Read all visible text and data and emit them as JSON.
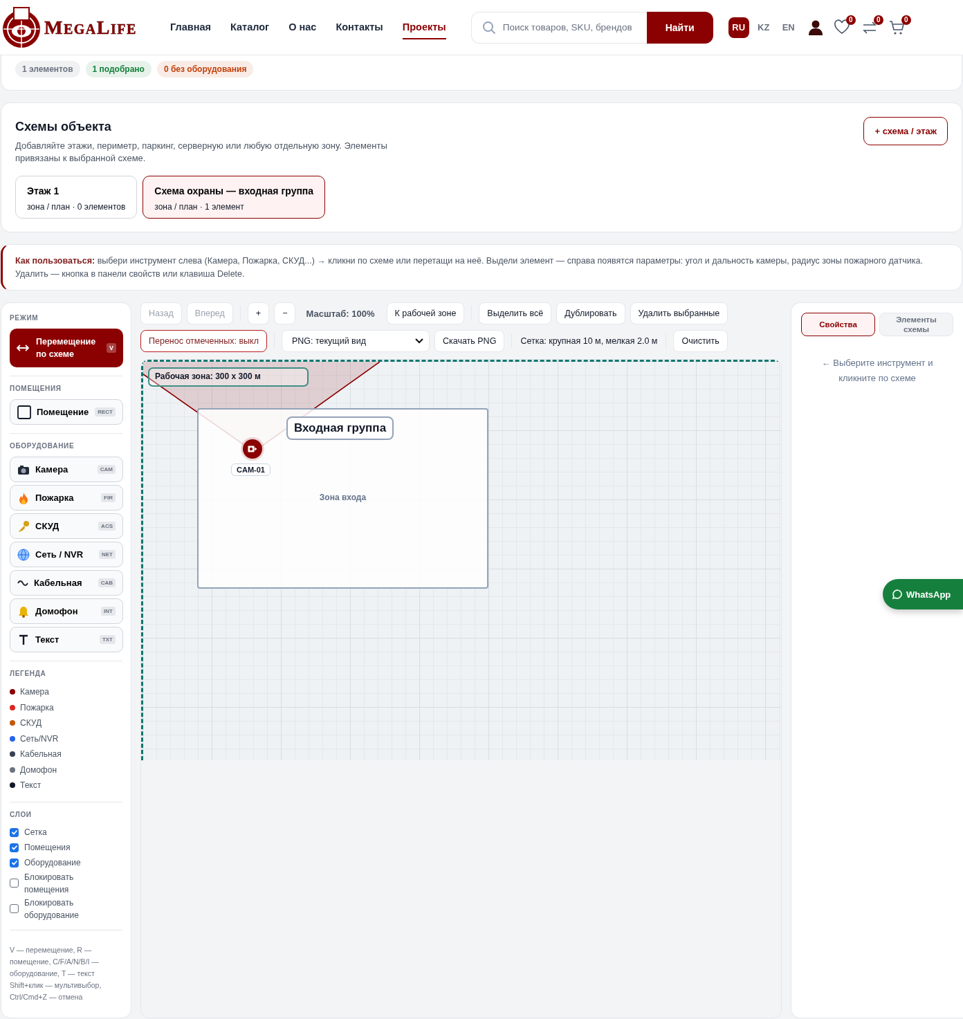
{
  "header": {
    "brand": "MegaLife",
    "nav": [
      {
        "label": "Главная",
        "selected": false
      },
      {
        "label": "Каталог",
        "selected": false
      },
      {
        "label": "О нас",
        "selected": false
      },
      {
        "label": "Контакты",
        "selected": false
      },
      {
        "label": "Проекты",
        "selected": true
      }
    ],
    "search": {
      "placeholder": "Поиск товаров, SKU, брендов",
      "button": "Найти"
    },
    "languages": [
      {
        "label": "RU",
        "selected": true
      },
      {
        "label": "KZ",
        "selected": false
      },
      {
        "label": "EN",
        "selected": false
      }
    ],
    "counters": [
      "0",
      "0",
      "0"
    ]
  },
  "stats": [
    {
      "text": "1 элементов",
      "color": "#6b7280"
    },
    {
      "text": "1 подобрано",
      "color": "#15803d"
    },
    {
      "text": "0 без оборудования",
      "color": "#c2410c"
    }
  ],
  "schemes": {
    "title": "Схемы объекта",
    "description": "Добавляйте этажи, периметр, паркинг, серверную или любую отдельную зону. Элементы привязаны к выбранной схеме.",
    "add_button": "+ схема / этаж",
    "items": [
      {
        "name": "Этаж 1",
        "meta": "зона / план · 0 элементов",
        "selected": false
      },
      {
        "name": "Схема охраны — входная группа",
        "meta": "зона / план · 1 элемент",
        "selected": true
      }
    ]
  },
  "help": "**Как пользоваться:** выбери инструмент слева (Камера, Пожарка, СКУД...) → кликни по схеме или перетащи на неё. Выдели элемент — справа появятся параметры: угол и дальность камеры, радиус зоны пожарного датчика. Удалить — кнопка в панели свойств или клавиша Delete.",
  "sidebar": {
    "mode_title": "РЕЖИМ",
    "mode": {
      "label": "Перемещение по схеме",
      "key": "V"
    },
    "rooms_title": "ПОМЕЩЕНИЯ",
    "rooms": [
      {
        "label": "Помещение",
        "code": "RECT"
      }
    ],
    "equipment_title": "ОБОРУДОВАНИЕ",
    "equipment": [
      {
        "label": "Камера",
        "code": "CAM"
      },
      {
        "label": "Пожарка",
        "code": "FIR"
      },
      {
        "label": "СКУД",
        "code": "ACS"
      },
      {
        "label": "Сеть / NVR",
        "code": "NET"
      },
      {
        "label": "Кабельная",
        "code": "CAB"
      },
      {
        "label": "Домофон",
        "code": "INT"
      },
      {
        "label": "Текст",
        "code": "TXT"
      }
    ],
    "legend_title": "ЛЕГЕНДА",
    "legend": [
      {
        "label": "Камера",
        "color": "#8b0000"
      },
      {
        "label": "Пожарка",
        "color": "#dc2626"
      },
      {
        "label": "СКУД",
        "color": "#c2570c"
      },
      {
        "label": "Сеть/NVR",
        "color": "#2563eb"
      },
      {
        "label": "Кабельная",
        "color": "#374151"
      },
      {
        "label": "Домофон",
        "color": "#6b7280"
      },
      {
        "label": "Текст",
        "color": "#111827"
      }
    ],
    "layers_title": "СЛОИ",
    "layers": [
      {
        "label": "Сетка",
        "checked": true
      },
      {
        "label": "Помещения",
        "checked": true
      },
      {
        "label": "Оборудование",
        "checked": true
      },
      {
        "label": "Блокировать помещения",
        "checked": false
      },
      {
        "label": "Блокировать оборудование",
        "checked": false
      }
    ],
    "hints": [
      "V — перемещение, R — помещение, C/F/A/N/B/I — оборудование, T — текст",
      "Shift+клик — мультивыбор, Ctrl/Cmd+Z — отмена"
    ]
  },
  "toolbar": [
    [
      [
        {
          "kind": "button",
          "label": "Назад",
          "disabled": true
        },
        {
          "kind": "button",
          "label": "Вперед",
          "disabled": true
        }
      ],
      [
        {
          "kind": "button",
          "label": "+",
          "disabled": false
        },
        {
          "kind": "button",
          "label": "−",
          "disabled": false
        },
        {
          "kind": "text",
          "label": "Масштаб: 100%"
        },
        {
          "kind": "button",
          "label": "К рабочей зоне",
          "disabled": false
        }
      ],
      [
        {
          "kind": "button",
          "label": "Выделить всё",
          "disabled": false
        },
        {
          "kind": "button",
          "label": "Дублировать",
          "disabled": false
        },
        {
          "kind": "button",
          "label": "Удалить выбранные",
          "disabled": false
        }
      ]
    ],
    [
      [
        {
          "kind": "toggle",
          "label": "Перенос отмеченных: выкл",
          "on": false
        }
      ],
      [
        {
          "kind": "select",
          "label": "PNG: текущий вид"
        },
        {
          "kind": "button",
          "label": "Скачать PNG",
          "disabled": false
        }
      ],
      [
        {
          "kind": "plain",
          "label": "Сетка: крупная 10 м, мелкая 2.0 м"
        }
      ],
      [
        {
          "kind": "button",
          "label": "Очистить",
          "disabled": false
        }
      ]
    ]
  ],
  "canvas": {
    "zone_label": "Рабочая зона: 300 x 300 м",
    "rooms": [
      {
        "name": "Входная группа",
        "caption": "Зона входа"
      }
    ],
    "devices": [
      {
        "label": "CAM-01",
        "color": "#8b0000"
      }
    ]
  },
  "panel": {
    "tabs": [
      {
        "label": "Свойства",
        "selected": true
      },
      {
        "label": "Элементы схемы",
        "selected": false
      }
    ],
    "hint": "← Выберите инструмент и кликните по схеме"
  },
  "whatsapp": "WhatsApp"
}
